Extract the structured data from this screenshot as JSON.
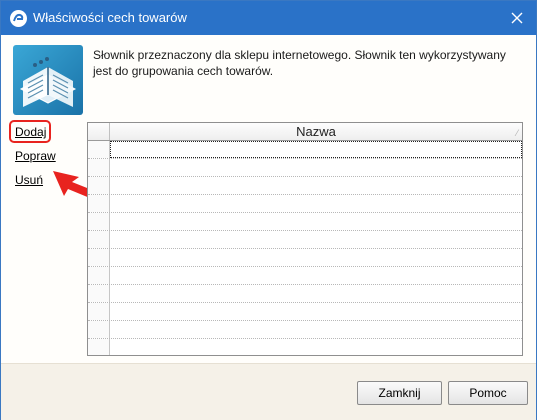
{
  "window": {
    "title": "Właściwości cech towarów"
  },
  "description": "Słownik przeznaczony dla sklepu internetowego. Słownik ten wykorzystywany jest do grupowania cech towarów.",
  "actions": {
    "add": "Dodaj",
    "edit": "Popraw",
    "delete": "Usuń"
  },
  "grid": {
    "columns": [
      "Nazwa"
    ],
    "rows": [
      [
        ""
      ],
      [
        ""
      ],
      [
        ""
      ],
      [
        ""
      ],
      [
        ""
      ],
      [
        ""
      ],
      [
        ""
      ],
      [
        ""
      ],
      [
        ""
      ],
      [
        ""
      ],
      [
        ""
      ],
      [
        ""
      ]
    ]
  },
  "footer": {
    "close_label": "Zamknij",
    "help_label": "Pomoc"
  },
  "colors": {
    "titlebar": "#2a72c8",
    "highlight": "#e8231f"
  },
  "icons": {
    "app": "app-logo-icon",
    "close": "close-icon",
    "dictionary": "book-icon",
    "annotation": "red-arrow-icon"
  }
}
